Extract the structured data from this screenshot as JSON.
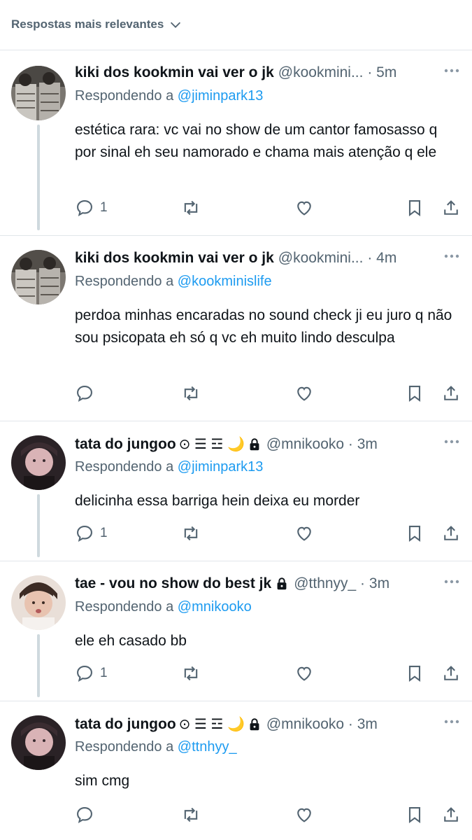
{
  "sort_bar": {
    "label": "Respostas mais relevantes"
  },
  "replying_prefix": "Respondendo a",
  "tweets": [
    {
      "name": "kiki dos kookmin vai ver o jk",
      "handle_time": "@kookmini... · 5m",
      "replying_to": "@jiminpark13",
      "text": "estética rara: vc vai no show de um cantor famosasso q por sinal eh seu namorado e chama mais atenção q ele",
      "reply_count": "1"
    },
    {
      "name": "kiki dos kookmin vai ver o jk",
      "handle_time": "@kookmini... · 4m",
      "replying_to": "@kookminislife",
      "text": "perdoa minhas encaradas no sound check ji eu juro q não sou psicopata eh só q vc eh muito lindo desculpa",
      "reply_count": ""
    },
    {
      "name": "tata do jungoo",
      "badges": "⊙ ☰ ☲ 🌙",
      "handle_time": "@mnikooko · 3m",
      "replying_to": "@jiminpark13",
      "text": "delicinha essa barriga hein deixa eu morder",
      "reply_count": "1"
    },
    {
      "name": "tae - vou no show do best jk",
      "handle_time": "@tthnyy_ · 3m",
      "replying_to": "@mnikooko",
      "text": "ele eh casado bb",
      "reply_count": "1"
    },
    {
      "name": "tata do jungoo",
      "badges": "⊙ ☰ ☲ 🌙",
      "handle_time": "@mnikooko · 3m",
      "replying_to": "@ttnhyy_",
      "text": "sim cmg",
      "reply_count": ""
    }
  ]
}
